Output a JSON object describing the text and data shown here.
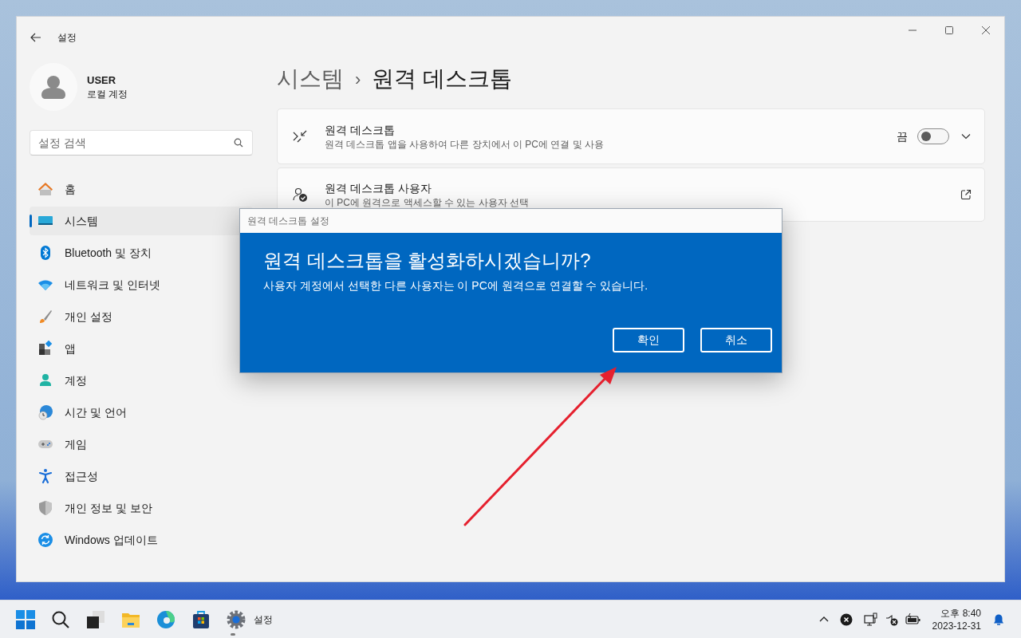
{
  "window": {
    "title": "설정"
  },
  "user": {
    "name": "USER",
    "account": "로컬 계정"
  },
  "search": {
    "placeholder": "설정 검색"
  },
  "nav": [
    {
      "kind": "home",
      "label": "홈",
      "selected": false
    },
    {
      "kind": "system",
      "label": "시스템",
      "selected": true
    },
    {
      "kind": "bluetooth",
      "label": "Bluetooth 및 장치",
      "selected": false
    },
    {
      "kind": "network",
      "label": "네트워크 및 인터넷",
      "selected": false
    },
    {
      "kind": "personalize",
      "label": "개인 설정",
      "selected": false
    },
    {
      "kind": "apps",
      "label": "앱",
      "selected": false
    },
    {
      "kind": "accounts",
      "label": "계정",
      "selected": false
    },
    {
      "kind": "time",
      "label": "시간 및 언어",
      "selected": false
    },
    {
      "kind": "gaming",
      "label": "게임",
      "selected": false
    },
    {
      "kind": "accessibility",
      "label": "접근성",
      "selected": false
    },
    {
      "kind": "privacy",
      "label": "개인 정보 및 보안",
      "selected": false
    },
    {
      "kind": "update",
      "label": "Windows 업데이트",
      "selected": false
    }
  ],
  "breadcrumb": {
    "parent": "시스템",
    "separator": "›",
    "current": "원격 데스크톱"
  },
  "cards": [
    {
      "kind": "toggle",
      "title": "원격 데스크톱",
      "description": "원격 데스크톱 앱을 사용하여 다른 장치에서 이 PC에 연결 및 사용",
      "state_label": "끔",
      "on": false
    },
    {
      "kind": "link",
      "title": "원격 데스크톱 사용자",
      "description": "이 PC에 원격으로 액세스할 수 있는 사용자 선택"
    }
  ],
  "dialog": {
    "title": "원격 데스크톱 설정",
    "heading": "원격 데스크톱을 활성화하시겠습니까?",
    "message": "사용자 계정에서 선택한 다른 사용자는 이 PC에 원격으로 연결할 수 있습니다.",
    "buttons": [
      "확인",
      "취소"
    ]
  },
  "taskbar": {
    "apps": [
      {
        "kind": "start"
      },
      {
        "kind": "search"
      },
      {
        "kind": "taskview"
      },
      {
        "kind": "explorer"
      },
      {
        "kind": "edge"
      },
      {
        "kind": "store"
      },
      {
        "kind": "settings",
        "label": "설정"
      }
    ],
    "time": "오후 8:40",
    "date": "2023-12-31"
  }
}
